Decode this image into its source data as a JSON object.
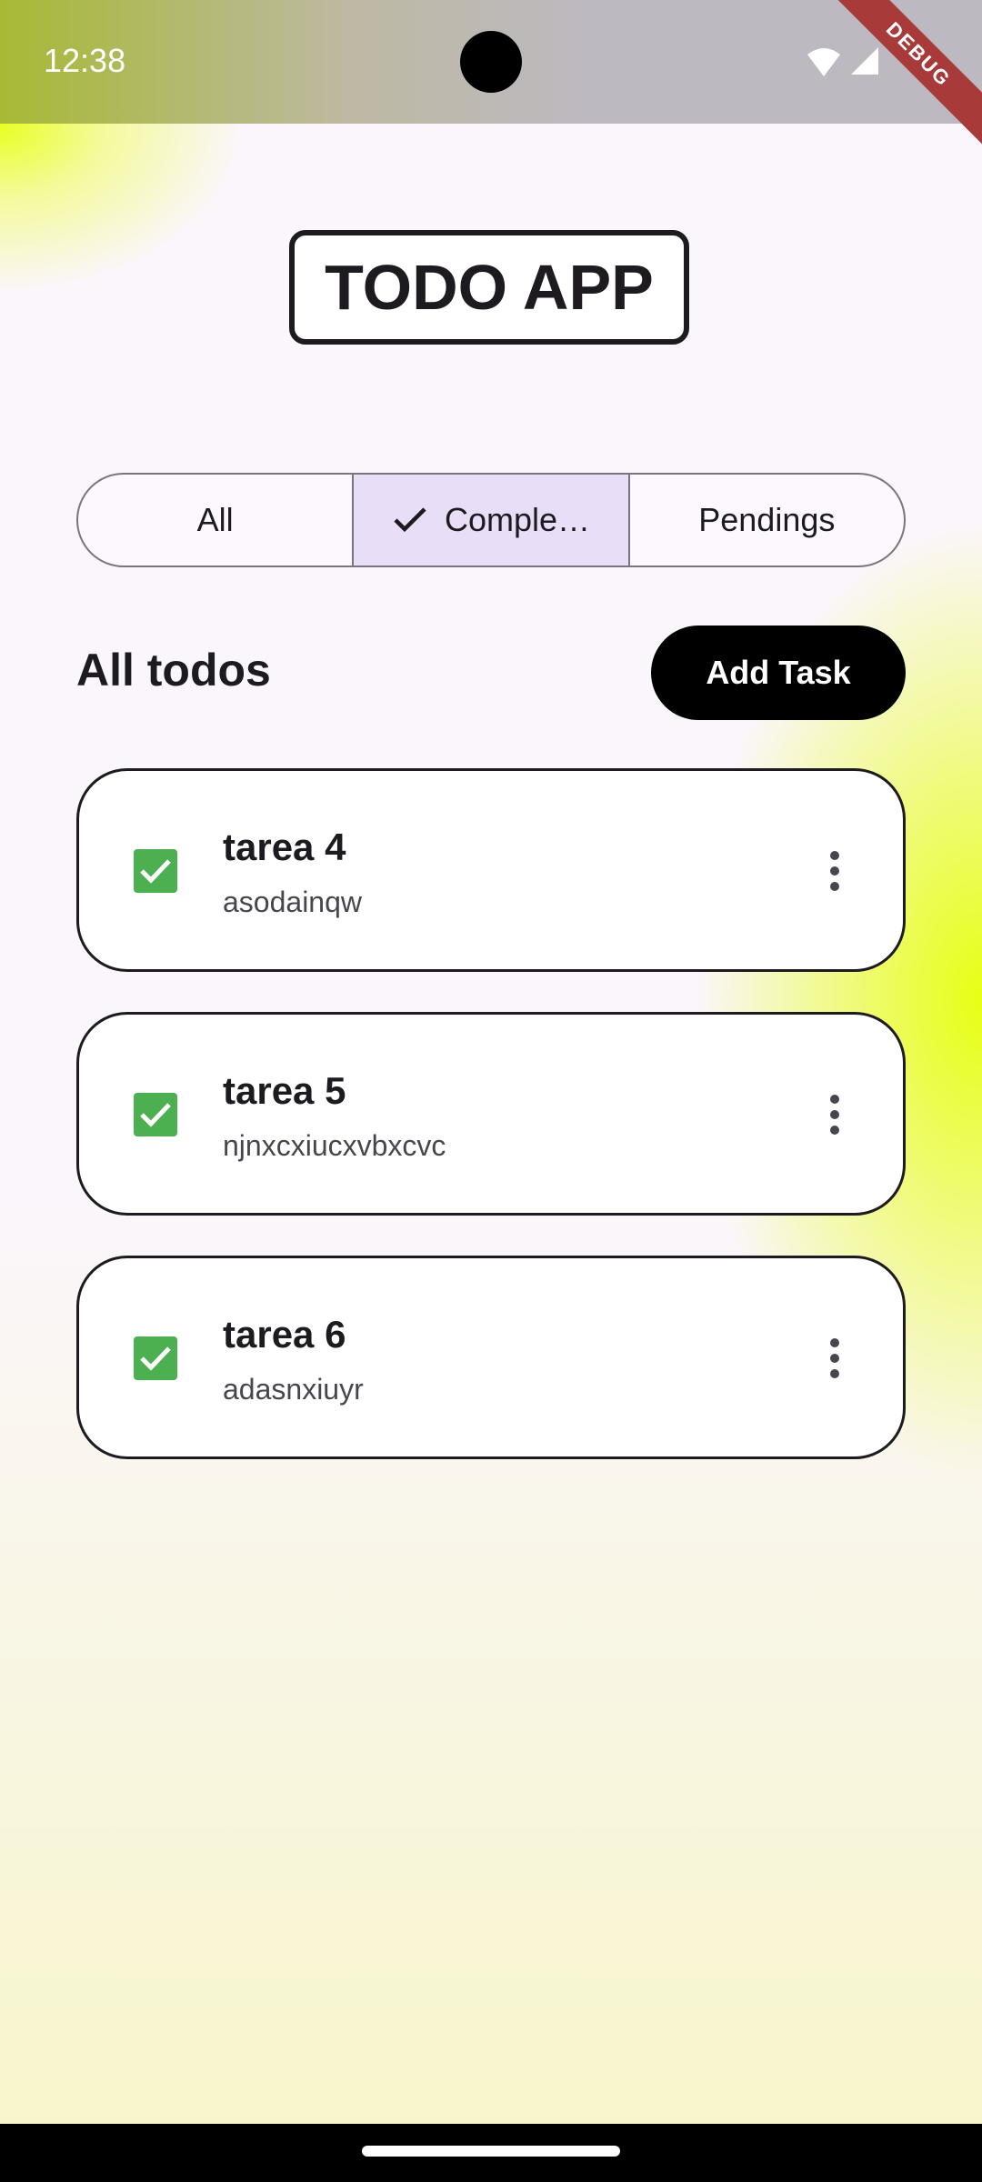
{
  "status_bar": {
    "time": "12:38",
    "debug_label": "DEBUG"
  },
  "app": {
    "title": "TODO APP"
  },
  "filters": {
    "items": [
      {
        "label": "All",
        "selected": false
      },
      {
        "label": "Comple…",
        "selected": true
      },
      {
        "label": "Pendings",
        "selected": false
      }
    ]
  },
  "list": {
    "heading": "All todos",
    "add_button_label": "Add Task",
    "todos": [
      {
        "title": "tarea 4",
        "description": "asodainqw",
        "completed": true
      },
      {
        "title": "tarea 5",
        "description": "njnxcxiucxvbxcvc",
        "completed": true
      },
      {
        "title": "tarea 6",
        "description": "adasnxiuyr",
        "completed": true
      }
    ]
  },
  "colors": {
    "accent_selected": "#e8def8",
    "checkbox": "#4caf50",
    "button_bg": "#000000",
    "debug_banner": "#a83a3a"
  },
  "icons": {
    "check": "check-icon",
    "checkbox": "checkbox-checked-icon",
    "menu": "more-vert-icon",
    "wifi": "wifi-icon",
    "signal": "signal-icon"
  }
}
